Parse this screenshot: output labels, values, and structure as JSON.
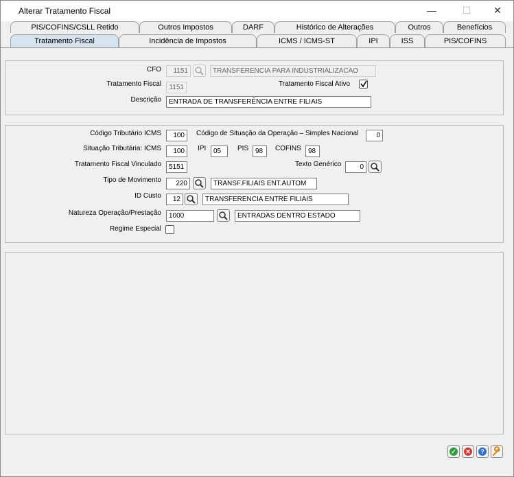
{
  "window": {
    "title": "Alterar Tratamento Fiscal",
    "minimize_glyph": "—",
    "maximize_glyph": "☐",
    "close_glyph": "✕"
  },
  "tabs_row1": [
    "PIS/COFINS/CSLL Retido",
    "Outros Impostos",
    "DARF",
    "Histórico de Alterações",
    "Outros",
    "Benefícios"
  ],
  "tabs_row2": [
    "Tratamento Fiscal",
    "Incidência de Impostos",
    "ICMS / ICMS-ST",
    "IPI",
    "ISS",
    "PIS/COFINS"
  ],
  "selected_tab": "Tratamento Fiscal",
  "header": {
    "cfo_label": "CFO",
    "cfo_value": "1151",
    "cfo_desc": "TRANSFERENCIA PARA INDUSTRIALIZACAO",
    "tf_label": "Tratamento Fiscal",
    "tf_value": "1151",
    "tf_ativo_label": "Tratamento Fiscal Ativo",
    "tf_ativo_checked": true,
    "descricao_label": "Descrição",
    "descricao_value": "ENTRADA DE TRANSFERÊNCIA ENTRE FILIAIS"
  },
  "details": {
    "cod_trib_label": "Código Tributário ICMS",
    "cod_trib_value": "100",
    "cod_sit_label": "Código de Situação da Operação – Simples Nacional",
    "cod_sit_value": "0",
    "sit_trib_label": "Situação Tributária: ICMS",
    "sit_trib_value": "100",
    "ipi_label": "IPI",
    "ipi_value": "05",
    "pis_label": "PIS",
    "pis_value": "98",
    "cofins_label": "COFINS",
    "cofins_value": "98",
    "tf_vinc_label": "Tratamento Fiscal Vinculado",
    "tf_vinc_value": "5151",
    "texto_gen_label": "Texto Genérico",
    "texto_gen_value": "0",
    "tipo_mov_label": "Tipo de Movimento",
    "tipo_mov_value": "220",
    "tipo_mov_desc": "TRANSF.FILIAIS ENT.AUTOM",
    "id_custo_label": "ID Custo",
    "id_custo_value": "12",
    "id_custo_desc": "TRANSFERENCIA ENTRE FILIAIS",
    "natureza_label": "Natureza Operação/Prestação",
    "natureza_value": "1000",
    "natureza_desc": "ENTRADAS DENTRO ESTADO",
    "regime_label": "Regime Especial",
    "regime_checked": false
  },
  "colors": {
    "ok": "#2e9e3a",
    "cancel": "#d43a2f",
    "help": "#2a6fd1",
    "tools": "#e08a1c",
    "selected_tab": "#d6e4ef"
  },
  "icons": [
    "search-icon",
    "check-icon",
    "cancel-icon",
    "help-icon",
    "wrench-icon"
  ]
}
